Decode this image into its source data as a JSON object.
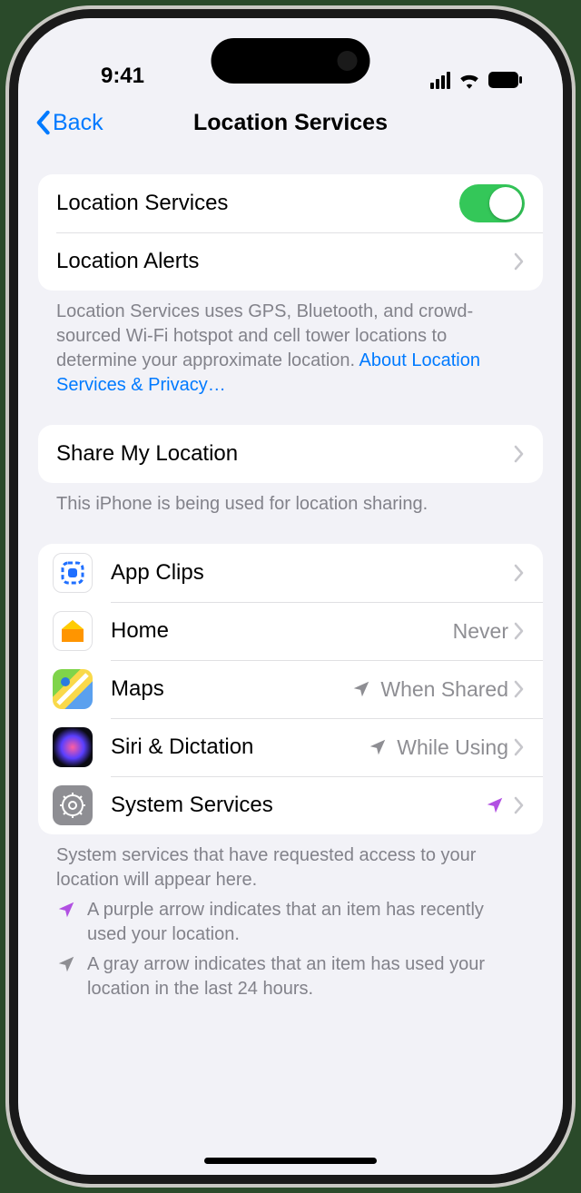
{
  "status": {
    "time": "9:41"
  },
  "nav": {
    "back": "Back",
    "title": "Location Services"
  },
  "group1": {
    "location_services_label": "Location Services",
    "location_services_on": true,
    "location_alerts_label": "Location Alerts"
  },
  "group1_footer": {
    "text": "Location Services uses GPS, Bluetooth, and crowd-sourced Wi-Fi hotspot and cell tower locations to determine your approximate location. ",
    "link": "About Location Services & Privacy…"
  },
  "group2": {
    "share_label": "Share My Location"
  },
  "group2_footer": "This iPhone is being used for location sharing.",
  "apps": [
    {
      "name": "App Clips",
      "value": "",
      "indicator": ""
    },
    {
      "name": "Home",
      "value": "Never",
      "indicator": ""
    },
    {
      "name": "Maps",
      "value": "When Shared",
      "indicator": "gray"
    },
    {
      "name": "Siri & Dictation",
      "value": "While Using",
      "indicator": "gray"
    },
    {
      "name": "System Services",
      "value": "",
      "indicator": "purple"
    }
  ],
  "apps_footer": "System services that have requested access to your location will appear here.",
  "legend": {
    "purple": "A purple arrow indicates that an item has recently used your location.",
    "gray": "A gray arrow indicates that an item has used your location in the last 24 hours."
  }
}
